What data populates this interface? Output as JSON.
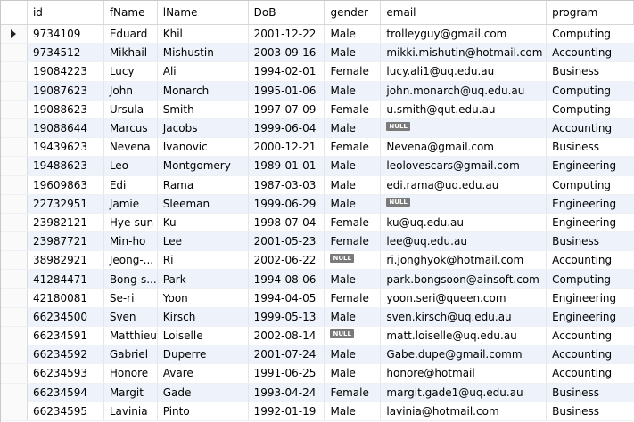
{
  "columns": [
    "id",
    "fName",
    "lName",
    "DoB",
    "gender",
    "email",
    "program"
  ],
  "current_row_icon": "current-row-arrow-icon",
  "null_label": "NULL",
  "rows": [
    {
      "id": "9734109",
      "fName": "Eduard",
      "lName": "Khil",
      "DoB": "2001-12-22",
      "gender": "Male",
      "email": "trolleyguy@gmail.com",
      "program": "Computing"
    },
    {
      "id": "9734512",
      "fName": "Mikhail",
      "lName": "Mishustin",
      "DoB": "2003-09-16",
      "gender": "Male",
      "email": "mikki.mishutin@hotmail.com",
      "program": "Accounting"
    },
    {
      "id": "19084223",
      "fName": "Lucy",
      "lName": "Ali",
      "DoB": "1994-02-01",
      "gender": "Female",
      "email": "lucy.ali1@uq.edu.au",
      "program": "Business"
    },
    {
      "id": "19087623",
      "fName": "John",
      "lName": "Monarch",
      "DoB": "1995-01-06",
      "gender": "Male",
      "email": "john.monarch@uq.edu.au",
      "program": "Computing"
    },
    {
      "id": "19088623",
      "fName": "Ursula",
      "lName": "Smith",
      "DoB": "1997-07-09",
      "gender": "Female",
      "email": "u.smith@qut.edu.au",
      "program": "Computing"
    },
    {
      "id": "19088644",
      "fName": "Marcus",
      "lName": "Jacobs",
      "DoB": "1999-06-04",
      "gender": "Male",
      "email": null,
      "program": "Accounting"
    },
    {
      "id": "19439623",
      "fName": "Nevena",
      "lName": "Ivanovic",
      "DoB": "2000-12-21",
      "gender": "Female",
      "email": "Nevena@gmail.com",
      "program": "Business"
    },
    {
      "id": "19488623",
      "fName": "Leo",
      "lName": "Montgomery",
      "DoB": "1989-01-01",
      "gender": "Male",
      "email": "leolovescars@gmail.com",
      "program": "Engineering"
    },
    {
      "id": "19609863",
      "fName": "Edi",
      "lName": "Rama",
      "DoB": "1987-03-03",
      "gender": "Male",
      "email": "edi.rama@uq.edu.au",
      "program": "Computing"
    },
    {
      "id": "22732951",
      "fName": "Jamie",
      "lName": "Sleeman",
      "DoB": "1999-06-29",
      "gender": "Male",
      "email": null,
      "program": "Engineering"
    },
    {
      "id": "23982121",
      "fName": "Hye-sun",
      "lName": "Ku",
      "DoB": "1998-07-04",
      "gender": "Female",
      "email": "ku@uq.edu.au",
      "program": "Engineering"
    },
    {
      "id": "23987721",
      "fName": "Min-ho",
      "lName": "Lee",
      "DoB": "2001-05-23",
      "gender": "Female",
      "email": "lee@uq.edu.au",
      "program": "Business"
    },
    {
      "id": "38982921",
      "fName": "Jeong-...",
      "lName": "Ri",
      "DoB": "2002-06-22",
      "gender": null,
      "email": "ri.jonghyok@hotmail.com",
      "program": "Accounting"
    },
    {
      "id": "41284471",
      "fName": "Bong-s...",
      "lName": "Park",
      "DoB": "1994-08-06",
      "gender": "Male",
      "email": "park.bongsoon@ainsoft.com",
      "program": "Computing"
    },
    {
      "id": "42180081",
      "fName": "Se-ri",
      "lName": "Yoon",
      "DoB": "1994-04-05",
      "gender": "Female",
      "email": "yoon.seri@queen.com",
      "program": "Engineering"
    },
    {
      "id": "66234500",
      "fName": "Sven",
      "lName": "Kirsch",
      "DoB": "1999-05-13",
      "gender": "Male",
      "email": "sven.kirsch@uq.edu.au",
      "program": "Engineering"
    },
    {
      "id": "66234591",
      "fName": "Matthieu",
      "lName": "Loiselle",
      "DoB": "2002-08-14",
      "gender": null,
      "email": "matt.loiselle@uq.edu.au",
      "program": "Accounting"
    },
    {
      "id": "66234592",
      "fName": "Gabriel",
      "lName": "Duperre",
      "DoB": "2001-07-24",
      "gender": "Male",
      "email": "Gabe.dupe@gmail.comm",
      "program": "Accounting"
    },
    {
      "id": "66234593",
      "fName": "Honore",
      "lName": "Avare",
      "DoB": "1991-06-25",
      "gender": "Male",
      "email": "honore@hotmail",
      "program": "Accounting"
    },
    {
      "id": "66234594",
      "fName": "Margit",
      "lName": "Gade",
      "DoB": "1993-04-24",
      "gender": "Female",
      "email": "margit.gade1@uq.edu.au",
      "program": "Business"
    },
    {
      "id": "66234595",
      "fName": "Lavinia",
      "lName": "Pinto",
      "DoB": "1992-01-19",
      "gender": "Male",
      "email": "lavinia@hotmail.com",
      "program": "Business"
    }
  ]
}
